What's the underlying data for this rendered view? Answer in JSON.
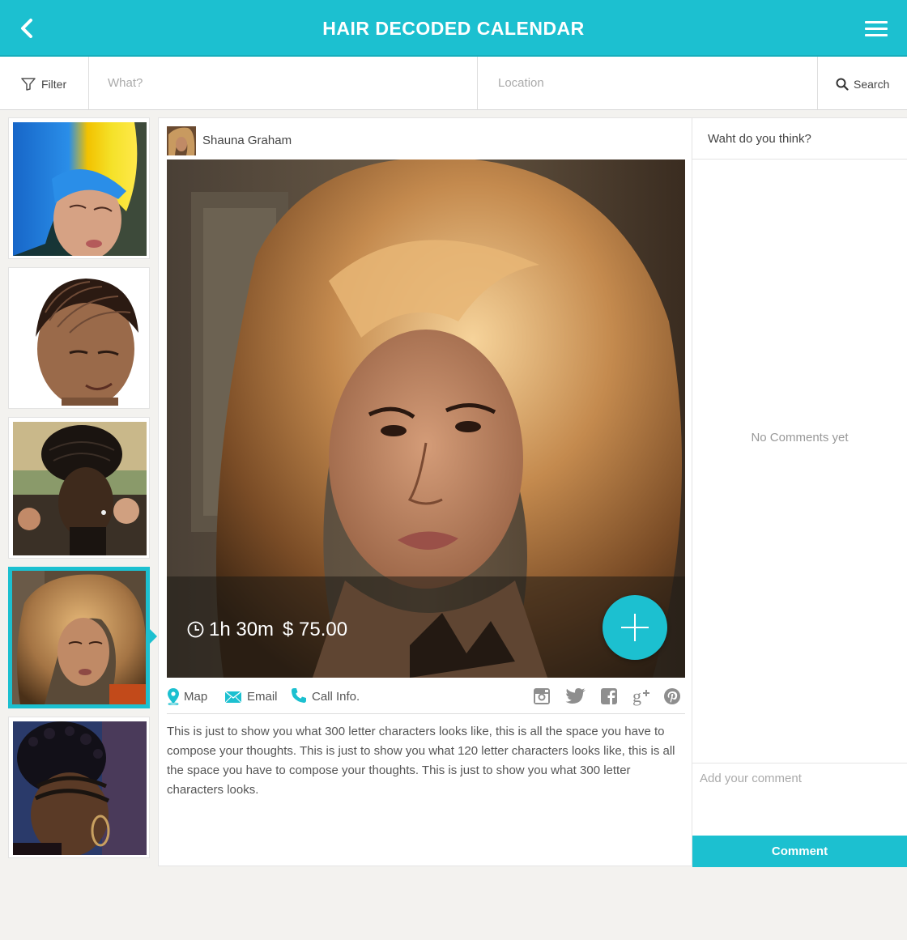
{
  "header": {
    "title": "HAIR DECODED CALENDAR",
    "back_icon": "chevron-left-icon",
    "menu_icon": "hamburger-icon"
  },
  "searchbar": {
    "filter_label": "Filter",
    "what_placeholder": "What?",
    "location_placeholder": "Location",
    "search_label": "Search"
  },
  "thumbnails": [
    {
      "label": "blue-yellow-hair"
    },
    {
      "label": "cornrows"
    },
    {
      "label": "braided-updo"
    },
    {
      "label": "blonde-curls",
      "active": true
    },
    {
      "label": "braided-mohawk"
    }
  ],
  "post": {
    "author": "Shauna Graham",
    "duration": "1h 30m",
    "price": "$ 75.00",
    "actions": {
      "map": "Map",
      "email": "Email",
      "call": "Call Info."
    },
    "social": [
      "instagram-icon",
      "twitter-icon",
      "facebook-icon",
      "google-plus-icon",
      "pinterest-icon"
    ],
    "description": "This is just to show you what 300 letter characters looks like, this is all the space you have to compose your thoughts. This is just to show you what 120 letter characters looks like, this is all the space you have to compose your thoughts. This is just to show you what 300 letter characters looks."
  },
  "comments": {
    "heading": "Waht do you think?",
    "empty": "No Comments yet",
    "input_placeholder": "Add your comment",
    "submit": "Comment"
  },
  "colors": {
    "accent": "#1cc0d0",
    "background": "#f3f2ef"
  }
}
